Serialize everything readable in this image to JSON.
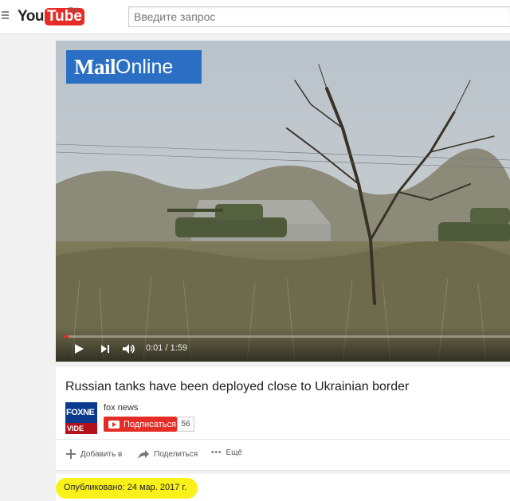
{
  "masthead": {
    "logo_you": "You",
    "logo_tube": "Tube",
    "region": "RU",
    "search_placeholder": "Введите запрос"
  },
  "player": {
    "brand_mail": "Mail",
    "brand_online": "Online",
    "time": "0:01 / 1:59",
    "progress": 0.01
  },
  "video": {
    "title": "Russian tanks have been deployed close to Ukrainian border",
    "channel": "fox news",
    "avatar_top": "FOXNE",
    "avatar_bottom": "VIDE",
    "subscribe_label": "Подписаться",
    "subscriber_count": "56",
    "actions": {
      "add": "Добавить в",
      "share": "Поделиться",
      "more": "Ещё"
    },
    "published": "Опубликовано: 24 мар. 2017 г."
  },
  "colors": {
    "accent": "#e52d27",
    "highlight": "#f8f000",
    "brand_blue": "#2b6fc4"
  }
}
